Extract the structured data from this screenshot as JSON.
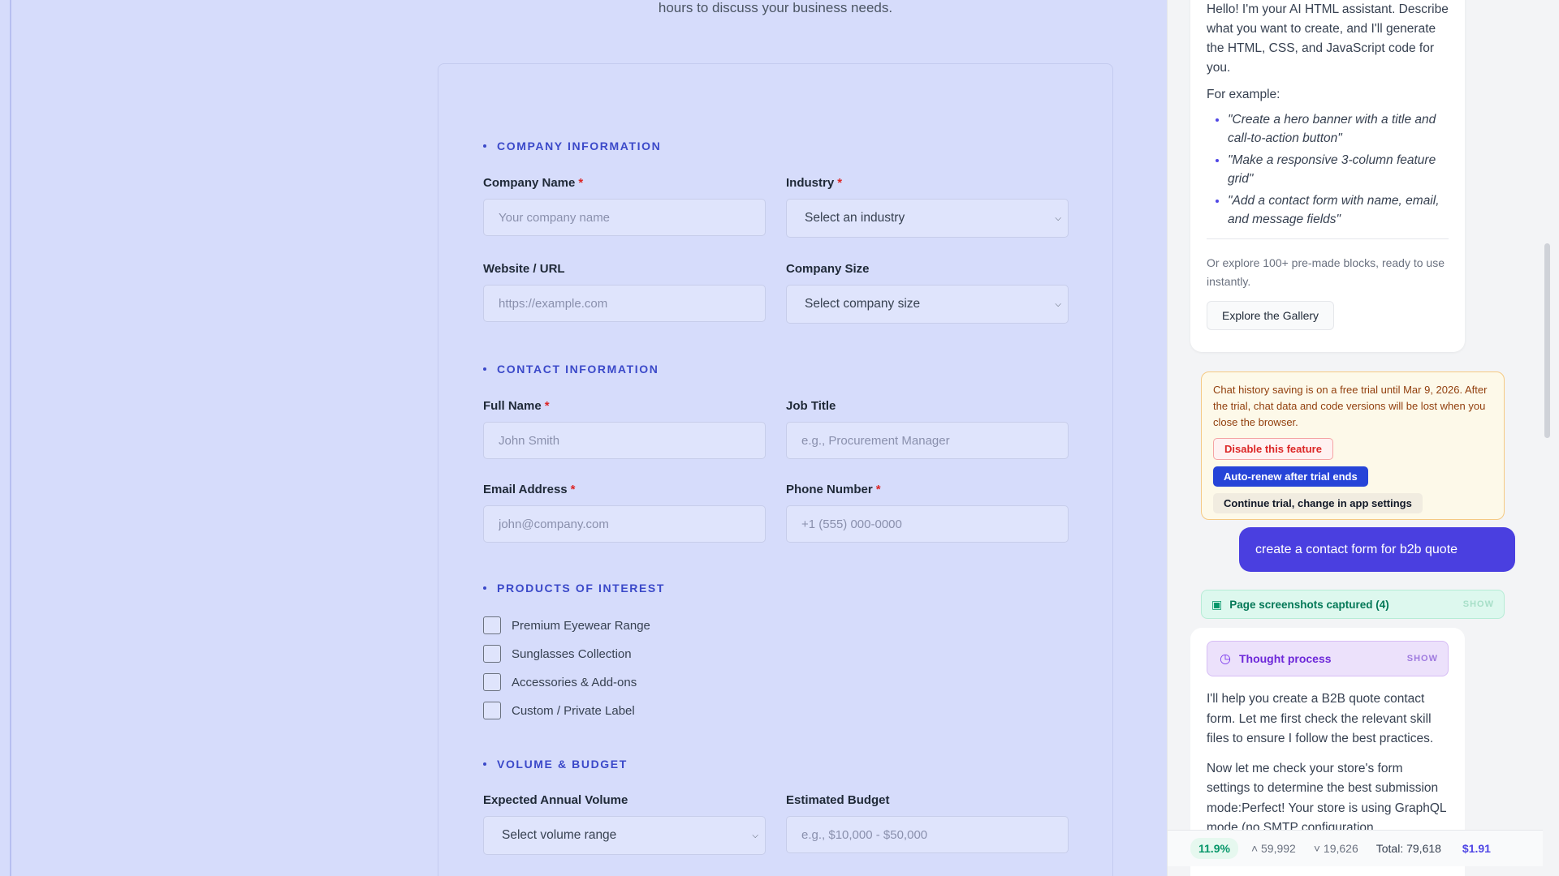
{
  "intro": {
    "text": "hours to discuss your business needs."
  },
  "form": {
    "company_section": "COMPANY INFORMATION",
    "contact_section": "CONTACT INFORMATION",
    "products_section": "PRODUCTS OF INTEREST",
    "volume_section": "VOLUME & BUDGET",
    "required_marker": "*",
    "company_name": {
      "label": "Company Name",
      "placeholder": "Your company name"
    },
    "industry": {
      "label": "Industry",
      "value": "Select an industry"
    },
    "website": {
      "label": "Website / URL",
      "placeholder": "https://example.com"
    },
    "company_size": {
      "label": "Company Size",
      "value": "Select company size"
    },
    "full_name": {
      "label": "Full Name",
      "placeholder": "John Smith"
    },
    "job_title": {
      "label": "Job Title",
      "placeholder": "e.g., Procurement Manager"
    },
    "email": {
      "label": "Email Address",
      "placeholder": "john@company.com"
    },
    "phone": {
      "label": "Phone Number",
      "placeholder": "+1 (555) 000-0000"
    },
    "products": [
      "Premium Eyewear Range",
      "Sunglasses Collection",
      "Accessories & Add-ons",
      "Custom / Private Label"
    ],
    "annual_volume": {
      "label": "Expected Annual Volume",
      "value": "Select volume range"
    },
    "budget": {
      "label": "Estimated Budget",
      "placeholder": "e.g., $10,000 - $50,000"
    }
  },
  "chat": {
    "greeting": "Hello! I'm your AI HTML assistant. Describe what you want to create, and I'll generate the HTML, CSS, and JavaScript code for you.",
    "example_title": "For example:",
    "examples": [
      "\"Create a hero banner with a title and call-to-action button\"",
      "\"Make a responsive 3-column feature grid\"",
      "\"Add a contact form with name, email, and message fields\""
    ],
    "explore_text": "Or explore 100+ pre-made blocks, ready to use instantly.",
    "gallery_button": "Explore the Gallery",
    "trial_text": "Chat history saving is on a free trial until Mar 9, 2026. After the trial, chat data and code versions will be lost when you close the browser.",
    "disable_button": "Disable this feature",
    "renew_button": "Auto-renew after trial ends",
    "continue_button": "Continue trial, change in app settings",
    "user_message": "create a contact form for b2b quote",
    "screenshots_label": "Page screenshots captured (4)",
    "show_label": "SHOW",
    "thought_label": "Thought process",
    "reply_1": "I'll help you create a B2B quote contact form. Let me first check the relevant skill files to ensure I follow the best practices.",
    "reply_2": "Now let me check your store's form settings to determine the best submission mode:Perfect! Your store is using GraphQL mode (no SMTP configuration"
  },
  "stats": {
    "percent": "11.9%",
    "up_tokens": "59,992",
    "down_tokens": "19,626",
    "total": "Total: 79,618",
    "cost": "$1.91"
  },
  "colors": {
    "accent": "#3b49c9",
    "user_bubble": "#4a3fe0",
    "preview_bg": "#d6dcfb"
  }
}
